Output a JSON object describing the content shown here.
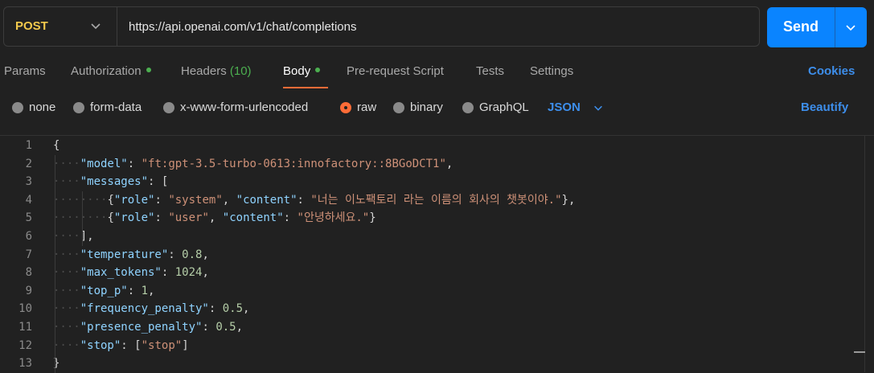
{
  "request": {
    "method": "POST",
    "url": "https://api.openai.com/v1/chat/completions",
    "send_label": "Send"
  },
  "tabs": [
    {
      "label": "Params"
    },
    {
      "label": "Authorization",
      "dot": true
    },
    {
      "label": "Headers",
      "count": "(10)"
    },
    {
      "label": "Body",
      "dot": true,
      "active": true
    },
    {
      "label": "Pre-request Script"
    },
    {
      "label": "Tests"
    },
    {
      "label": "Settings"
    }
  ],
  "cookies_label": "Cookies",
  "body_types": [
    {
      "label": "none"
    },
    {
      "label": "form-data"
    },
    {
      "label": "x-www-form-urlencoded"
    },
    {
      "label": "raw",
      "selected": true
    },
    {
      "label": "binary"
    },
    {
      "label": "GraphQL"
    }
  ],
  "format_label": "JSON",
  "beautify_label": "Beautify",
  "code_lines": [
    "{",
    "    \"model\": \"ft:gpt-3.5-turbo-0613:innofactory::8BGoDCT1\",",
    "    \"messages\": [",
    "        {\"role\": \"system\", \"content\": \"너는 이노팩토리 라는 이름의 회사의 챗봇이야.\"},",
    "        {\"role\": \"user\", \"content\": \"안녕하세요.\"}",
    "    ],",
    "    \"temperature\": 0.8,",
    "    \"max_tokens\": 1024,",
    "    \"top_p\": 1,",
    "    \"frequency_penalty\": 0.5,",
    "    \"presence_penalty\": 0.5,",
    "    \"stop\": [\"stop\"]",
    "}"
  ],
  "colors": {
    "accent": "#ff6c37",
    "link": "#3d8eeb",
    "send": "#0a84ff",
    "method": "#f2c94c",
    "dot": "#4caf50"
  }
}
